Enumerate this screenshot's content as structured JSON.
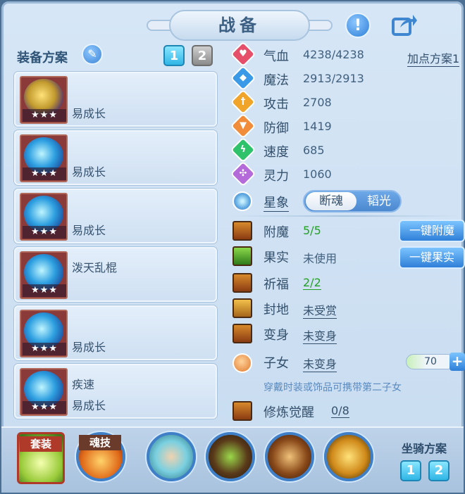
{
  "header": {
    "title": "战备",
    "alert_icon": "exclamation-icon",
    "share_icon": "share-icon"
  },
  "equip_plan": {
    "title": "装备方案",
    "tabs": [
      "1",
      "2"
    ],
    "active_tab": "1",
    "items": [
      {
        "name": "",
        "growth": "易成长",
        "stars": "★★★",
        "art": "gold"
      },
      {
        "name": "",
        "growth": "易成长",
        "stars": "★★★",
        "art": "blue"
      },
      {
        "name": "",
        "growth": "易成长",
        "stars": "★★★",
        "art": "blue"
      },
      {
        "name": "泼天乱棍",
        "growth": "",
        "stars": "★★★",
        "art": "blue"
      },
      {
        "name": "",
        "growth": "易成长",
        "stars": "★★★",
        "art": "blue"
      },
      {
        "name": "疾速",
        "growth": "易成长",
        "stars": "★★★",
        "art": "blue"
      }
    ]
  },
  "attributes": {
    "plan_link": "加点方案1",
    "rows": [
      {
        "label": "气血",
        "value": "4238/4238",
        "color": "#e64f6a",
        "icon": "heart-icon"
      },
      {
        "label": "魔法",
        "value": "2913/2913",
        "color": "#3a9ae8",
        "icon": "magic-icon"
      },
      {
        "label": "攻击",
        "value": "2708",
        "color": "#f0a42a",
        "icon": "attack-icon"
      },
      {
        "label": "防御",
        "value": "1419",
        "color": "#f08c3a",
        "icon": "defense-icon"
      },
      {
        "label": "速度",
        "value": "685",
        "color": "#2ec26a",
        "icon": "speed-icon"
      },
      {
        "label": "灵力",
        "value": "1060",
        "color": "#b46ad8",
        "icon": "spirit-icon"
      }
    ]
  },
  "star": {
    "label": "星象",
    "option_on": "断魂",
    "option_off": "韬光"
  },
  "functions": {
    "fumo": {
      "label": "附魔",
      "value": "5/5"
    },
    "guoshi": {
      "label": "果实",
      "value": "未使用"
    },
    "qifu": {
      "label": "祈福",
      "value": "2/2"
    },
    "fengdi": {
      "label": "封地",
      "value": "未受赏"
    },
    "bianshen": {
      "label": "变身",
      "value": "未变身"
    },
    "zinv": {
      "label": "子女",
      "value": "未变身",
      "level": "70"
    },
    "xiulian": {
      "label": "修炼觉醒",
      "value": "0/8"
    },
    "hint": "穿戴时装或饰品可携带第二子女",
    "btn_fumo": "一键附魔",
    "btn_guoshi": "一键果实"
  },
  "bottom": {
    "suit_label": "套装",
    "soul_label": "魂技",
    "mount_title": "坐骑方案",
    "mount_tabs": [
      "1",
      "2"
    ]
  }
}
